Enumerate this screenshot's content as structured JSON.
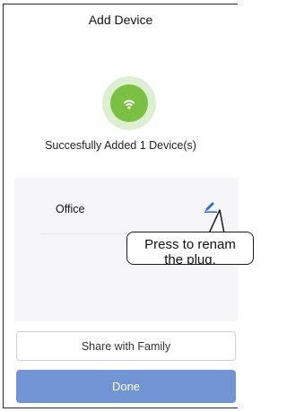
{
  "header": {
    "title": "Add Device"
  },
  "status": {
    "icon": "wifi-success-icon",
    "text": "Succesfully Added 1 Device(s)",
    "accent_color": "#7cc043"
  },
  "device": {
    "name": "Office",
    "edit_icon": "pencil-edit-icon",
    "edit_icon_color": "#2f6fd1"
  },
  "callout": {
    "line1": "Press to renam",
    "line2": "the plug."
  },
  "actions": {
    "share_label": "Share with Family",
    "done_label": "Done",
    "done_color": "#7195d4"
  }
}
